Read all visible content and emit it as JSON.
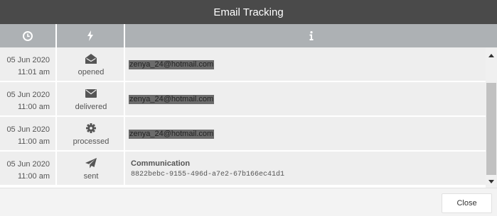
{
  "dialog": {
    "title": "Email Tracking",
    "close_label": "Close"
  },
  "table": {
    "header_icons": [
      "clock-icon",
      "bolt-icon",
      "info-icon"
    ],
    "rows": [
      {
        "date": "05 Jun 2020",
        "time": "11:01 am",
        "event_icon": "envelope-open-icon",
        "event": "opened",
        "email": "zenya_24@hotmail.com"
      },
      {
        "date": "05 Jun 2020",
        "time": "11:00 am",
        "event_icon": "envelope-icon",
        "event": "delivered",
        "email": "zenya_24@hotmail.com"
      },
      {
        "date": "05 Jun 2020",
        "time": "11:00 am",
        "event_icon": "gear-icon",
        "event": "processed",
        "email": "zenya_24@hotmail.com"
      },
      {
        "date": "05 Jun 2020",
        "time": "11:00 am",
        "event_icon": "paper-plane-icon",
        "event": "sent",
        "info_title": "Communication",
        "info_id": "8822bebc-9155-496d-a7e2-67b166ec41d1"
      }
    ]
  },
  "colors": {
    "titlebar": "#4a4a4a",
    "header": "#adb1b4",
    "row": "#eeeeee",
    "email_highlight": "#6b6b6b"
  }
}
